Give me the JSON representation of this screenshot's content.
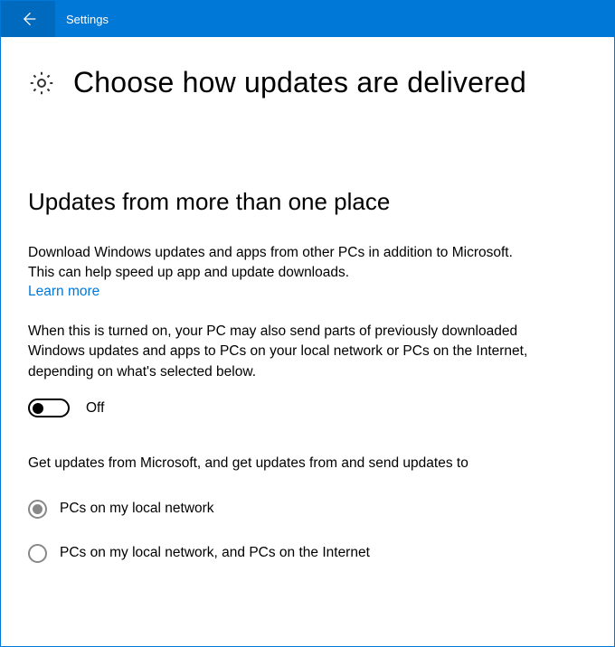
{
  "titlebar": {
    "app_name": "Settings"
  },
  "header": {
    "page_title": "Choose how updates are delivered"
  },
  "section": {
    "heading": "Updates from more than one place",
    "description1": "Download Windows updates and apps from other PCs in addition to Microsoft. This can help speed up app and update downloads.",
    "learn_more": "Learn more",
    "description2": "When this is turned on, your PC may also send parts of previously downloaded Windows updates and apps to PCs on your local network or PCs on the Internet, depending on what's selected below.",
    "toggle": {
      "state_label": "Off",
      "value": false
    },
    "subtext": "Get updates from Microsoft, and get updates from and send updates to",
    "radio_options": [
      {
        "label": "PCs on my local network",
        "selected": true
      },
      {
        "label": "PCs on my local network, and PCs on the Internet",
        "selected": false
      }
    ]
  }
}
